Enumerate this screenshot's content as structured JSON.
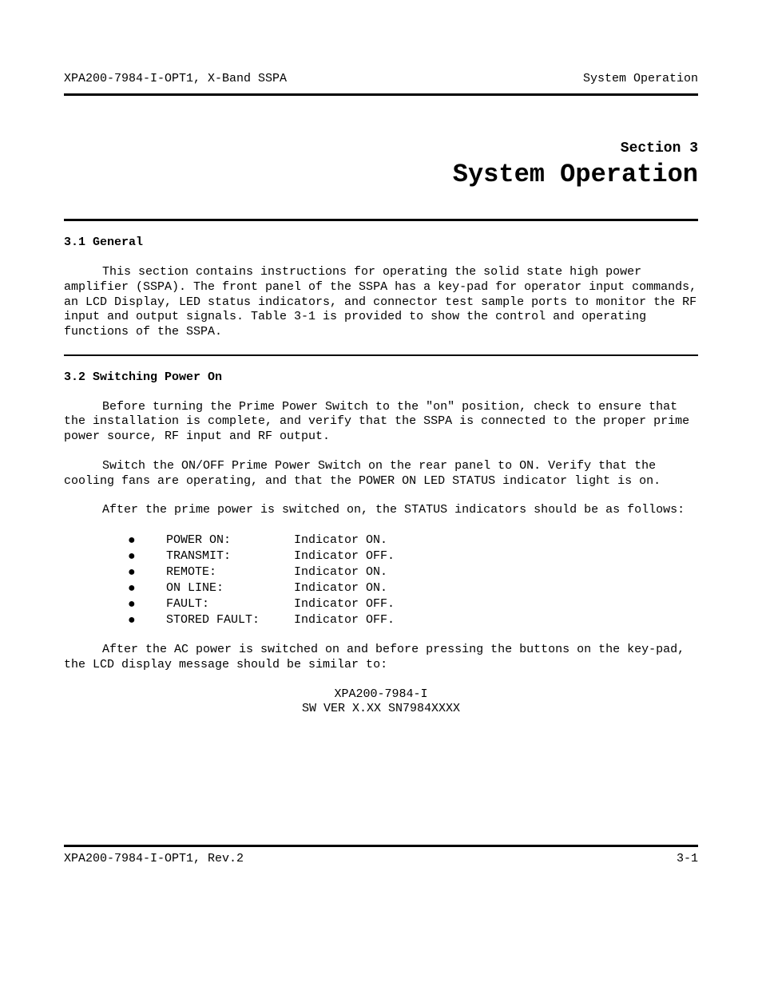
{
  "header": {
    "left": "XPA200-7984-I-OPT1, X-Band SSPA",
    "right": "System Operation"
  },
  "section": {
    "label": "Section 3",
    "title": "System Operation"
  },
  "sub1": {
    "heading": "3.1  General",
    "p1": "This section contains instructions for operating the solid state high power amplifier (SSPA).  The front panel of the SSPA has a key-pad for operator input commands, an LCD Display, LED status indicators, and connector test sample ports to monitor the RF input and output signals.  Table 3-1 is provided to show the control and operating functions of the SSPA."
  },
  "sub2": {
    "heading": "3.2  Switching Power On",
    "p1": "Before turning the Prime Power Switch to the \"on\" position, check to ensure that the installation is complete, and verify that the SSPA is connected to the proper prime power source, RF input and RF output.",
    "p2": "Switch the ON/OFF Prime Power Switch on the rear panel to ON.  Verify that the cooling fans are operating, and that the POWER ON LED STATUS indicator light is on.",
    "p3": "After the prime power is switched on, the STATUS indicators should be as follows:",
    "indicators": [
      {
        "label": "POWER ON:",
        "value": "Indicator ON."
      },
      {
        "label": "TRANSMIT:",
        "value": "Indicator OFF."
      },
      {
        "label": "REMOTE:",
        "value": "Indicator ON."
      },
      {
        "label": "ON LINE:",
        "value": "Indicator ON."
      },
      {
        "label": "FAULT:",
        "value": "Indicator OFF."
      },
      {
        "label": "STORED FAULT:",
        "value": "Indicator OFF."
      }
    ],
    "p4": "After the AC power is switched on and before pressing the buttons on the key-pad, the LCD display message should be similar to:",
    "lcd": {
      "line1": "XPA200-7984-I",
      "line2": "SW VER X.XX SN7984XXXX"
    }
  },
  "footer": {
    "left": "XPA200-7984-I-OPT1, Rev.2",
    "right": "3-1"
  }
}
